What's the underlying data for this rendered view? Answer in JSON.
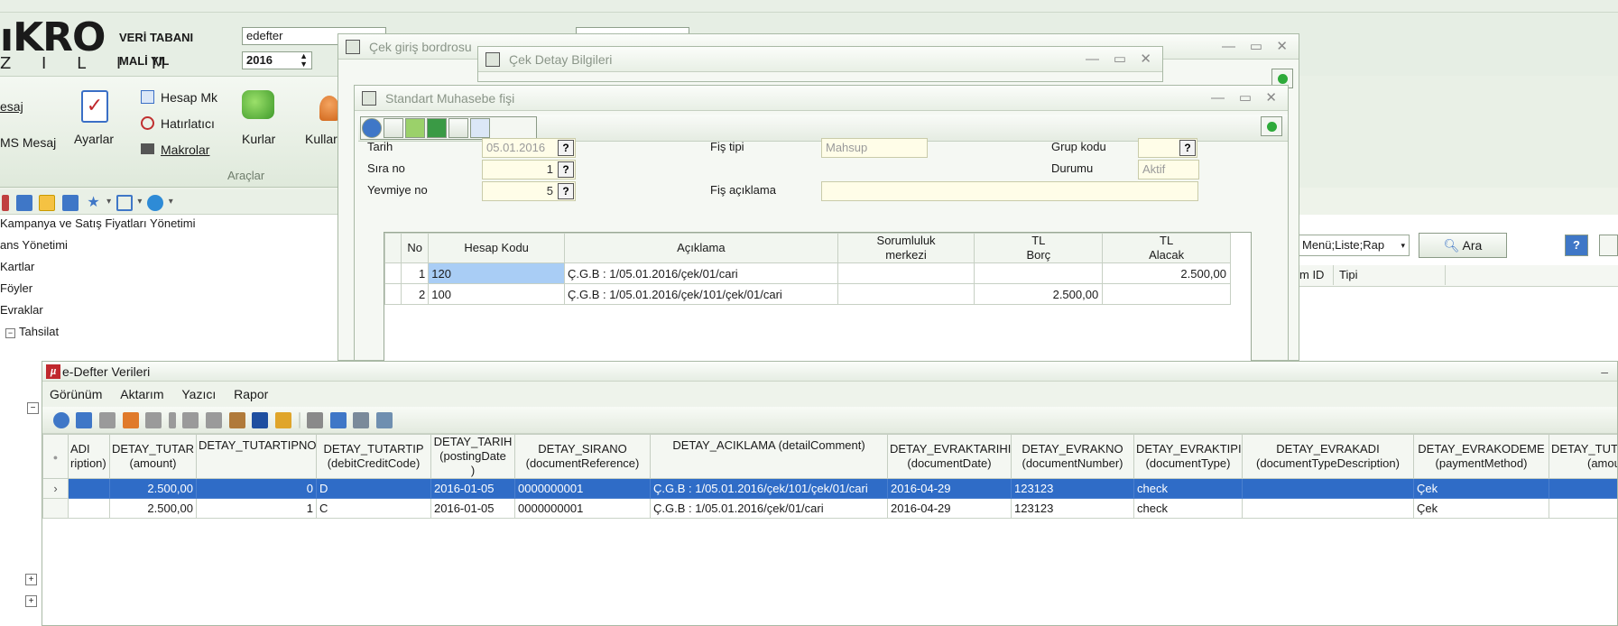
{
  "header": {
    "logo_text": "ıKRO",
    "logo_sub": "Z I L I M",
    "db_label": "VERİ TABANI",
    "db_value": "edefter",
    "year_label": "MALİ YIL",
    "year_value": "2016"
  },
  "ribbon": {
    "mesaj": "esaj",
    "sms_mesaj": "MS Mesaj",
    "ayarlar": "Ayarlar",
    "hesap_mk": "Hesap Mk",
    "hatirlatici": "Hatırlatıcı",
    "makrolar": "Makrolar",
    "kurlar": "Kurlar",
    "kullan": "Kullar",
    "group_araclar": "Araçlar"
  },
  "tree": {
    "items": [
      "Kampanya ve Satış Fiyatları Yönetimi",
      "ans Yönetimi",
      "Kartlar",
      "Föyler",
      "Evraklar",
      "Tahsilat"
    ]
  },
  "right_panel": {
    "menu_select": "Menü;Liste;Rap",
    "ara_button": "Ara",
    "col_id": "m ID",
    "col_tipi": "Tipi"
  },
  "win_cek_giris": {
    "title": "Çek giriş bordrosu"
  },
  "win_cek_detay": {
    "title": "Çek Detay Bilgileri"
  },
  "win_muhasebe": {
    "title": "Standart Muhasebe fişi",
    "tarih_label": "Tarih",
    "tarih_value": "05.01.2016",
    "sira_label": "Sıra no",
    "sira_value": "1",
    "yevmiye_label": "Yevmiye no",
    "yevmiye_value": "5",
    "fistipi_label": "Fiş tipi",
    "fistipi_value": "Mahsup",
    "fisaciklama_label": "Fiş açıklama",
    "grupkodu_label": "Grup kodu",
    "durumu_label": "Durumu",
    "durumu_value": "Aktif",
    "q": "?",
    "columns": [
      "No",
      "Hesap Kodu",
      "Açıklama",
      "Sorumluluk merkezi",
      "TL Borç",
      "TL Alacak"
    ],
    "col_sorumluluk_1": "Sorumluluk",
    "col_sorumluluk_2": "merkezi",
    "col_borc_1": "TL",
    "col_borc_2": "Borç",
    "col_alacak_1": "TL",
    "col_alacak_2": "Alacak",
    "rows": [
      {
        "no": "1",
        "hesap": "120",
        "aciklama": "Ç.G.B : 1/05.01.2016/çek/01/cari",
        "sorumluluk": "",
        "borc": "",
        "alacak": "2.500,00"
      },
      {
        "no": "2",
        "hesap": "100",
        "aciklama": "Ç.G.B : 1/05.01.2016/çek/101/çek/01/cari",
        "sorumluluk": "",
        "borc": "2.500,00",
        "alacak": ""
      }
    ]
  },
  "edefter": {
    "title": "e-Defter Verileri",
    "menu": [
      "Görünüm",
      "Aktarım",
      "Yazıcı",
      "Rapor"
    ],
    "columns": [
      {
        "l1": "ADI",
        "l2": "ription)"
      },
      {
        "l1": "DETAY_TUTAR",
        "l2": "(amount)"
      },
      {
        "l1": "DETAY_TUTARTIPNO",
        "l2": ""
      },
      {
        "l1": "DETAY_TUTARTIP",
        "l2": "(debitCreditCode)"
      },
      {
        "l1": "DETAY_TARIH",
        "l2": "(postingDate",
        "l3": ")"
      },
      {
        "l1": "DETAY_SIRANO",
        "l2": "(documentReference)"
      },
      {
        "l1": "DETAY_ACIKLAMA (detailComment)",
        "l2": ""
      },
      {
        "l1": "DETAY_EVRAKTARIHI",
        "l2": "(documentDate)"
      },
      {
        "l1": "DETAY_EVRAKNO",
        "l2": "(documentNumber)"
      },
      {
        "l1": "DETAY_EVRAKTIPI",
        "l2": "(documentType)"
      },
      {
        "l1": "DETAY_EVRAKADI",
        "l2": "(documentTypeDescription)"
      },
      {
        "l1": "DETAY_EVRAKODEME",
        "l2": "(paymentMethod)"
      },
      {
        "l1": "DETAY_TUT",
        "l2": "(amou"
      }
    ],
    "rows": [
      [
        "",
        "2.500,00",
        "0",
        "D",
        "2016-01-05",
        "0000000001",
        "Ç.G.B : 1/05.01.2016/çek/101/çek/01/cari",
        "2016-04-29",
        "123123",
        "check",
        "",
        "Çek",
        ""
      ],
      [
        "",
        "2.500,00",
        "1",
        "C",
        "2016-01-05",
        "0000000001",
        "Ç.G.B : 1/05.01.2016/çek/01/cari",
        "2016-04-29",
        "123123",
        "check",
        "",
        "Çek",
        ""
      ]
    ]
  }
}
